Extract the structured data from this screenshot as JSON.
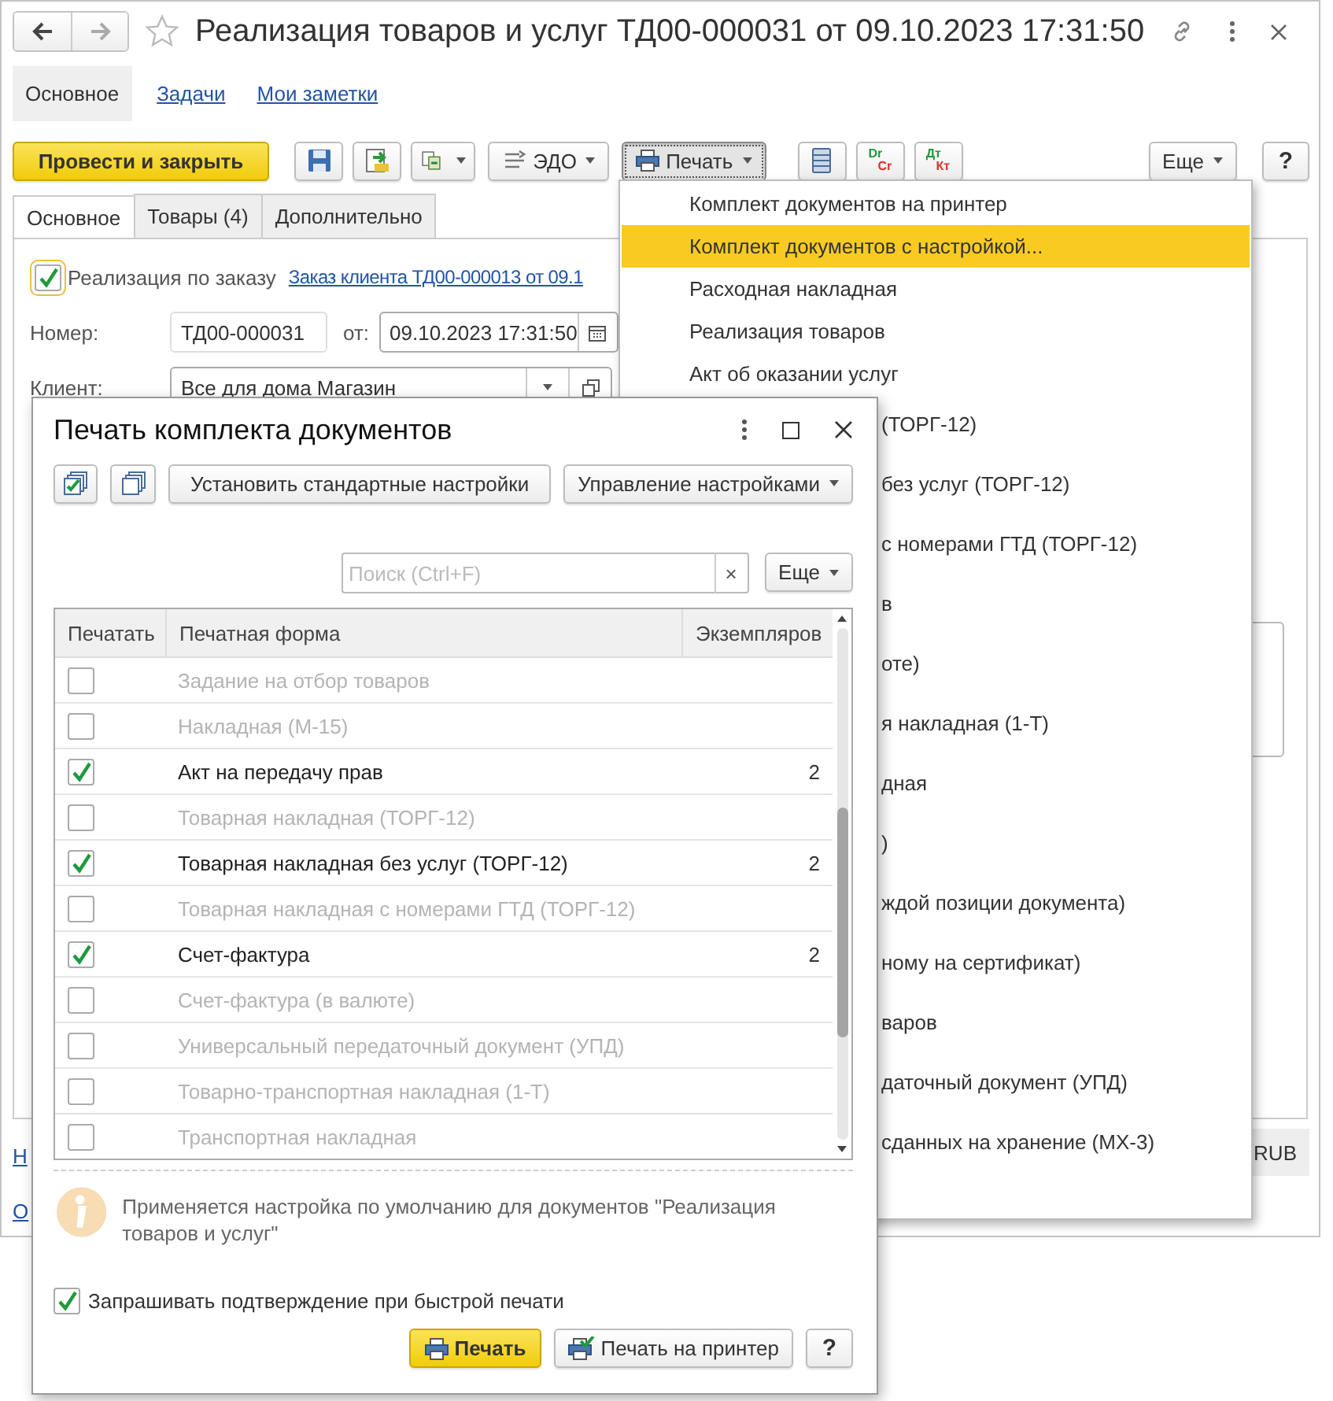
{
  "window": {
    "title": "Реализация товаров и услуг ТД00-000031 от 09.10.2023 17:31:50"
  },
  "sections": [
    {
      "label": "Основное",
      "selected": true
    },
    {
      "label": "Задачи",
      "selected": false
    },
    {
      "label": "Мои заметки",
      "selected": false
    }
  ],
  "toolbar": {
    "post_button": "Провести и закрыть",
    "edo_button": "ЭДО",
    "print_button": {
      "label": "Печать",
      "pressed": true
    },
    "dr_cr": [
      "Dr",
      "Cr"
    ],
    "dt_kt": [
      "Дт",
      "Кт"
    ],
    "more_button": "Еще",
    "help_button": "?"
  },
  "tabs": [
    {
      "label": "Основное",
      "selected": true
    },
    {
      "label": "Товары (4)",
      "selected": false
    },
    {
      "label": "Дополнительно",
      "selected": false
    }
  ],
  "form": {
    "by_order": {
      "label": "Реализация по заказу",
      "checked": true
    },
    "order_link": "Заказ клиента ТД00-000013 от 09.1",
    "number_label": "Номер:",
    "number": "ТД00-000031",
    "date_label": "от:",
    "date": "09.10.2023 17:31:50",
    "client_label": "Клиент:",
    "client": "Все для дома Магазин",
    "currency": "RUB",
    "links": [
      "Н",
      "О"
    ]
  },
  "print_menu": {
    "items": [
      {
        "text": "Комплект документов на принтер",
        "highlighted": false,
        "covered": false
      },
      {
        "text": "Комплект документов с настройкой...",
        "highlighted": true,
        "covered": false
      },
      {
        "text": "Расходная накладная",
        "highlighted": false,
        "covered": false
      },
      {
        "text": "Реализация товаров",
        "highlighted": false,
        "covered": false
      },
      {
        "text": "Акт об оказании услуг",
        "highlighted": false,
        "covered": false
      },
      {
        "text": "(ТОРГ-12)",
        "highlighted": false,
        "covered": true
      },
      {
        "text": "без услуг (ТОРГ-12)",
        "highlighted": false,
        "covered": true
      },
      {
        "text": "с номерами ГТД (ТОРГ-12)",
        "highlighted": false,
        "covered": true
      },
      {
        "text": "в",
        "highlighted": false,
        "covered": true
      },
      {
        "text": "оте)",
        "highlighted": false,
        "covered": true
      },
      {
        "text": "я накладная (1-Т)",
        "highlighted": false,
        "covered": true
      },
      {
        "text": "дная",
        "highlighted": false,
        "covered": true
      },
      {
        "text": ")",
        "highlighted": false,
        "covered": true
      },
      {
        "text": "ждой позиции документа)",
        "highlighted": false,
        "covered": true
      },
      {
        "text": "ному на сертификат)",
        "highlighted": false,
        "covered": true
      },
      {
        "text": "варов",
        "highlighted": false,
        "covered": true
      },
      {
        "text": "даточный документ (УПД)",
        "highlighted": false,
        "covered": true
      },
      {
        "text": "сданных на хранение (МХ-3)",
        "highlighted": false,
        "covered": true
      }
    ]
  },
  "dialog": {
    "title": "Печать комплекта документов",
    "reset_button": "Установить стандартные настройки",
    "settings_button": "Управление настройками",
    "search": {
      "placeholder": "Поиск (Ctrl+F)"
    },
    "clear_button": "×",
    "more_button": "Еще",
    "table": {
      "columns": [
        "Печатать",
        "Печатная форма",
        "Экземпляров"
      ],
      "rows": [
        {
          "print": false,
          "name": "Задание на отбор товаров"
        },
        {
          "print": false,
          "name": "Накладная (М-15)"
        },
        {
          "print": true,
          "name": "Акт на передачу прав",
          "copies": "2"
        },
        {
          "print": false,
          "name": "Товарная накладная (ТОРГ-12)"
        },
        {
          "print": true,
          "name": "Товарная накладная без услуг (ТОРГ-12)",
          "copies": "2"
        },
        {
          "print": false,
          "name": "Товарная накладная с номерами ГТД (ТОРГ-12)"
        },
        {
          "print": true,
          "name": "Счет-фактура",
          "copies": "2"
        },
        {
          "print": false,
          "name": "Счет-фактура (в валюте)"
        },
        {
          "print": false,
          "name": "Универсальный передаточный документ (УПД)"
        },
        {
          "print": false,
          "name": "Товарно-транспортная накладная (1-Т)"
        },
        {
          "print": false,
          "name": "Транспортная накладная"
        }
      ]
    },
    "info": "Применяется настройка по умолчанию для документов \"Реализация товаров и услуг\"",
    "confirm": {
      "label": "Запрашивать подтверждение при быстрой печати",
      "checked": true
    },
    "print_button": "Печать",
    "printer_button": "Печать на принтер",
    "help_button": "?"
  }
}
